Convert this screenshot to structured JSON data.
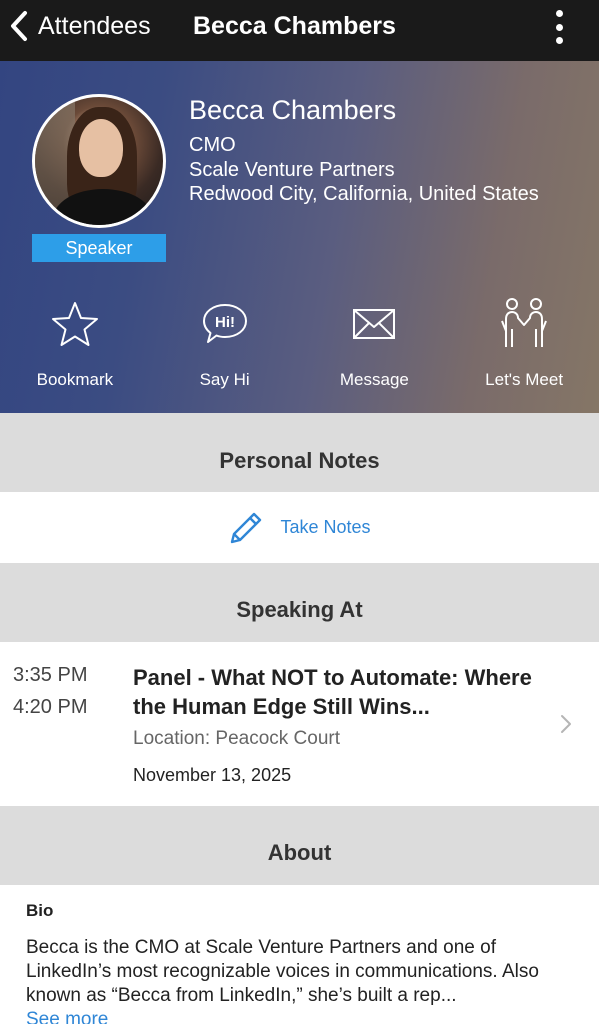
{
  "nav": {
    "back_label": "Attendees",
    "title": "Becca Chambers"
  },
  "profile": {
    "name": "Becca Chambers",
    "title": "CMO",
    "company": "Scale Venture Partners",
    "location": "Redwood City, California, United States",
    "badge": "Speaker"
  },
  "actions": [
    {
      "label": "Bookmark",
      "icon": "star-icon"
    },
    {
      "label": "Say Hi",
      "icon": "say-hi-icon"
    },
    {
      "label": "Message",
      "icon": "envelope-icon"
    },
    {
      "label": "Let's Meet",
      "icon": "handshake-people-icon"
    }
  ],
  "notes": {
    "header": "Personal Notes",
    "take_notes_label": "Take Notes"
  },
  "speaking": {
    "header": "Speaking At",
    "session": {
      "start": "3:35 PM",
      "end": "4:20 PM",
      "title": "Panel - What NOT to Automate: Where the Human Edge Still Wins...",
      "location": "Location: Peacock Court",
      "date": "November 13, 2025"
    }
  },
  "about": {
    "header": "About",
    "bio_label": "Bio",
    "bio_text": "Becca is the CMO at Scale Venture Partners and one of LinkedIn’s most recognizable voices in communications. Also known as “Becca from LinkedIn,” she’s built a rep...",
    "see_more": "See more"
  },
  "colors": {
    "accent": "#2f86d6",
    "badge": "#2d9ee8",
    "navbar": "#1a1a1a",
    "section_header": "#dcdcdc"
  }
}
